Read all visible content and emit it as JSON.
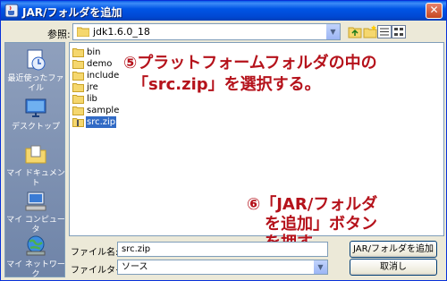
{
  "window": {
    "title": "JAR/フォルダを追加",
    "close_glyph": "✕"
  },
  "toolbar": {
    "lookin_label": "参照:",
    "lookin_value": "jdk1.6.0_18"
  },
  "places": [
    {
      "label": "最近使ったファイル",
      "icon": "recent-documents-icon"
    },
    {
      "label": "デスクトップ",
      "icon": "desktop-icon"
    },
    {
      "label": "マイ ドキュメント",
      "icon": "my-documents-icon"
    },
    {
      "label": "マイ コンピュータ",
      "icon": "my-computer-icon"
    },
    {
      "label": "マイ ネットワーク",
      "icon": "my-network-icon"
    }
  ],
  "files": [
    {
      "name": "bin",
      "type": "folder"
    },
    {
      "name": "demo",
      "type": "folder"
    },
    {
      "name": "include",
      "type": "folder"
    },
    {
      "name": "jre",
      "type": "folder"
    },
    {
      "name": "lib",
      "type": "folder"
    },
    {
      "name": "sample",
      "type": "folder"
    },
    {
      "name": "src.zip",
      "type": "zip",
      "selected": true
    }
  ],
  "annotations": {
    "step5_line1": "⑤プラットフォームフォルダの中の",
    "step5_line2": "「src.zip」を選択する。",
    "step6_line1": "⑥「JAR/フォルダ",
    "step6_line2": "を追加」ボタン",
    "step6_line3": "を押す。"
  },
  "form": {
    "filename_label": "ファイル名:",
    "filename_value": "src.zip",
    "filetype_label": "ファイルタイプ:",
    "filetype_value": "ソース"
  },
  "buttons": {
    "add_label": "JAR/フォルダを追加",
    "cancel_label": "取消し"
  },
  "colors": {
    "titlebar": "#0055e5",
    "selection": "#316ac5",
    "annotation": "#b5121b"
  }
}
